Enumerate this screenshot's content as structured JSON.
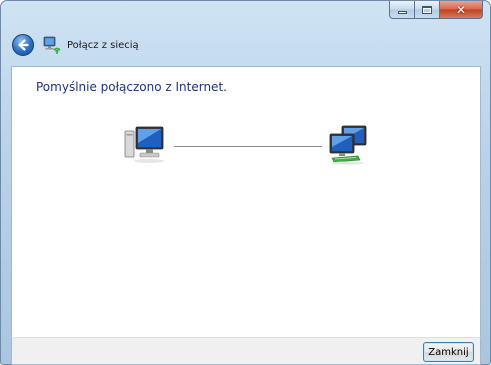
{
  "window": {
    "title": "Połącz z siecią",
    "caption_buttons": {
      "minimize_icon": "minimize-icon",
      "maximize_icon": "maximize-icon",
      "close_icon": "close-icon",
      "close_glyph": "✕"
    }
  },
  "nav": {
    "back_icon": "back-arrow-icon",
    "network_icon": "network-connection-icon"
  },
  "main": {
    "status_message": "Pomyślnie połączono z Internet.",
    "left_icon": "computer-icon",
    "right_icon": "network-computers-icon"
  },
  "footer": {
    "close_label": "Zamknij"
  },
  "colors": {
    "status_text": "#1e3287",
    "accent": "#3c7fb1"
  }
}
